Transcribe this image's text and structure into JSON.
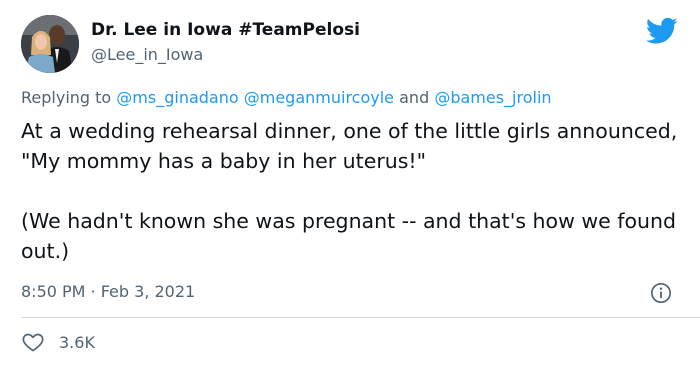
{
  "author": {
    "display_name": "Dr. Lee in Iowa #TeamPelosi",
    "handle": "@Lee_in_Iowa",
    "avatar_icon": "profile-photo"
  },
  "reply": {
    "prefix": "Replying to ",
    "mentions": [
      "@ms_ginadano",
      "@meganmuircoyle",
      "@bames_jrolin"
    ],
    "joiner": " and "
  },
  "tweet": {
    "paragraphs": [
      "At a wedding rehearsal dinner, one of the little girls announced, \"My mommy has a baby in her uterus!\"",
      "(We hadn't known she was pregnant -- and that's how we found out.)"
    ],
    "timestamp": "8:50 PM · Feb 3, 2021"
  },
  "actions": {
    "like_count": "3.6K"
  },
  "icons": {
    "brand": "twitter-bird-icon",
    "info": "info-icon",
    "like": "heart-icon"
  },
  "colors": {
    "accent": "#1d9bf0",
    "text": "#0f1419",
    "secondary": "#536471",
    "divider": "#cfd9de"
  }
}
